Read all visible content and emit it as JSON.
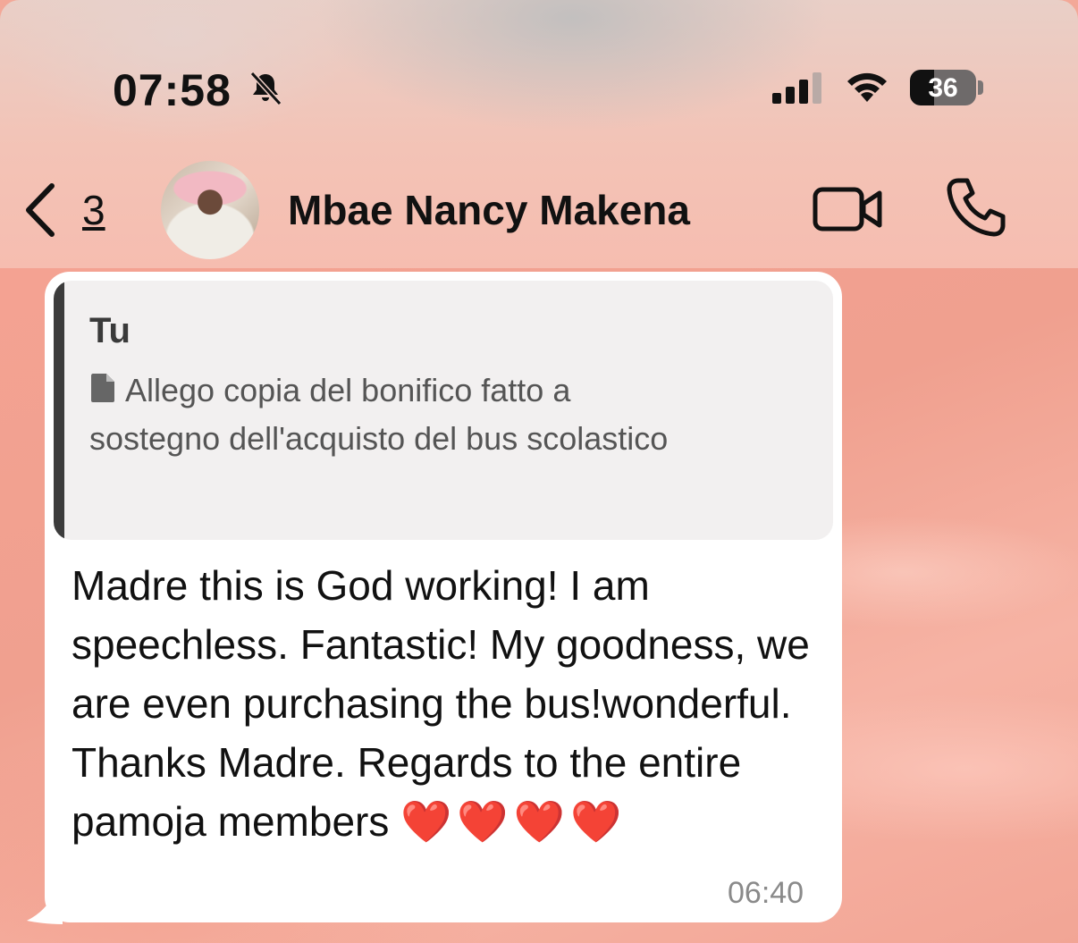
{
  "status_bar": {
    "time": "07:58",
    "battery_percent": "36",
    "battery_level": 0.36,
    "icons": [
      "bell-slash-icon",
      "cellular-signal-icon",
      "wifi-icon",
      "battery-icon"
    ]
  },
  "header": {
    "back_count": "3",
    "contact_name": "Mbae Nancy Makena",
    "icons": [
      "chevron-left-icon",
      "video-call-icon",
      "phone-icon"
    ]
  },
  "message": {
    "quoted": {
      "author": "Tu",
      "text": "Allego copia del bonifico fatto a sostegno dell'acquisto del bus scolastico",
      "icon": "document-icon"
    },
    "text": "Madre this is God working! I am speechless. Fantastic! My goodness, we are even purchasing the bus!wonderful.\nThanks Madre. Regards to the entire pamoja members ",
    "emoji": "❤️❤️❤️❤️",
    "time": "06:40"
  },
  "colors": {
    "wallpaper": "#f3a898",
    "bubble": "#ffffff",
    "quote_background": "#f2f0f0",
    "quote_bar": "#3c3c3c",
    "heart": "#e21b1b"
  }
}
